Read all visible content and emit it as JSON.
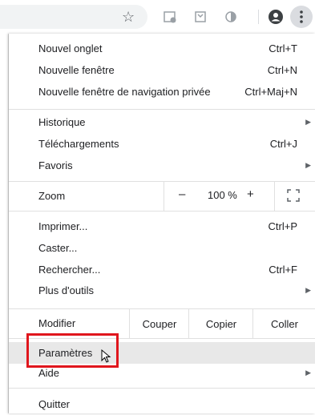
{
  "menu": {
    "items": [
      {
        "label": "Nouvel onglet",
        "shortcut": "Ctrl+T"
      },
      {
        "label": "Nouvelle fenêtre",
        "shortcut": "Ctrl+N"
      },
      {
        "label": "Nouvelle fenêtre de navigation privée",
        "shortcut": "Ctrl+Maj+N"
      },
      {
        "label": "Historique"
      },
      {
        "label": "Téléchargements",
        "shortcut": "Ctrl+J"
      },
      {
        "label": "Favoris"
      },
      {
        "label": "Imprimer...",
        "shortcut": "Ctrl+P"
      },
      {
        "label": "Caster..."
      },
      {
        "label": "Rechercher...",
        "shortcut": "Ctrl+F"
      },
      {
        "label": "Plus d'outils"
      },
      {
        "label": "Paramètres"
      },
      {
        "label": "Aide"
      },
      {
        "label": "Quitter"
      }
    ],
    "zoom": {
      "label": "Zoom",
      "minus": "–",
      "value": "100 %",
      "plus": "+"
    },
    "edit": {
      "label": "Modifier",
      "cut": "Couper",
      "copy": "Copier",
      "paste": "Coller"
    },
    "submenu_arrow": "▶"
  },
  "toolbar": {
    "bookmark_star": "☆"
  },
  "colors": {
    "highlight_box": "#e0161d",
    "hover_bg": "#e8e8e8"
  }
}
